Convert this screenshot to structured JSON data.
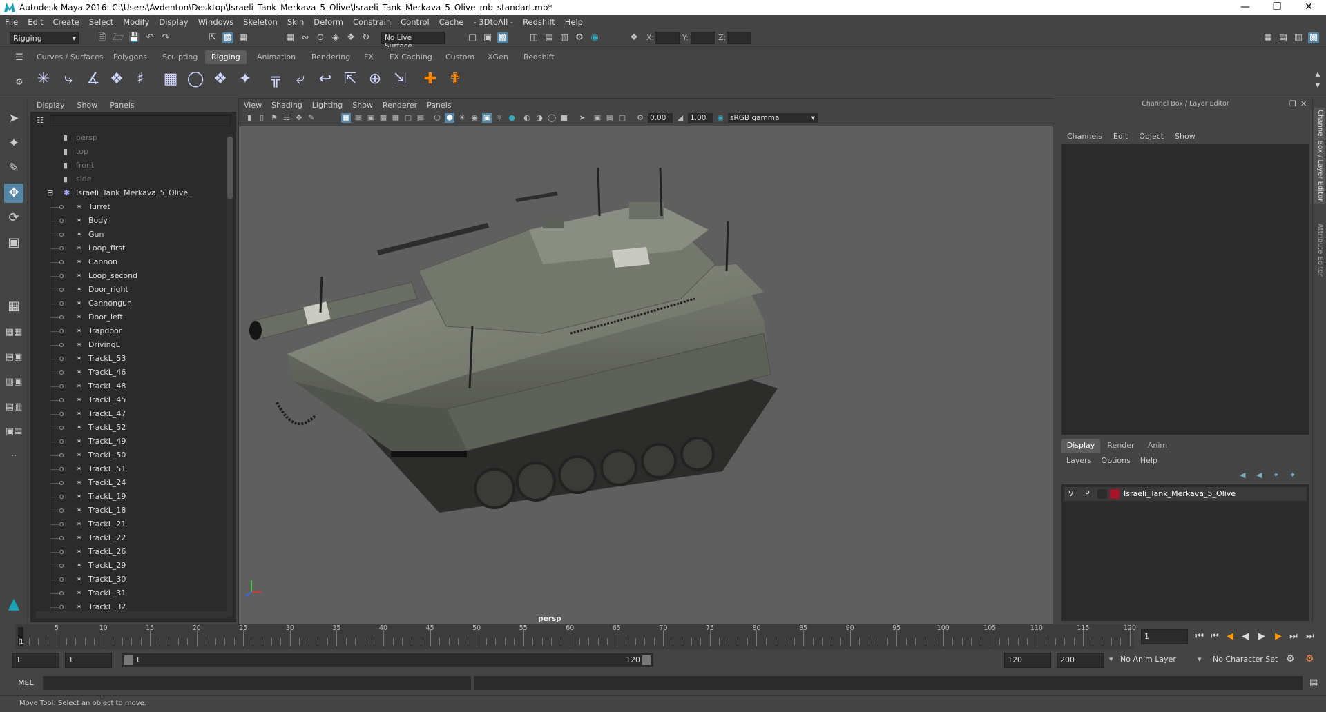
{
  "window": {
    "title": "Autodesk Maya 2016: C:\\Users\\Avdenton\\Desktop\\Israeli_Tank_Merkava_5_Olive\\Israeli_Tank_Merkava_5_Olive_mb_standart.mb*"
  },
  "menubar": [
    "File",
    "Edit",
    "Create",
    "Select",
    "Modify",
    "Display",
    "Windows",
    "Skeleton",
    "Skin",
    "Deform",
    "Constrain",
    "Control",
    "Cache",
    "- 3DtoAll -",
    "Redshift",
    "Help"
  ],
  "statusline": {
    "menuset": "Rigging",
    "live_surface": "No Live Surface",
    "x_label": "X:",
    "y_label": "Y:",
    "z_label": "Z:"
  },
  "shelf_tabs": [
    "Curves / Surfaces",
    "Polygons",
    "Sculpting",
    "Rigging",
    "Animation",
    "Rendering",
    "FX",
    "FX Caching",
    "Custom",
    "XGen",
    "Redshift"
  ],
  "shelf_selected": "Rigging",
  "outliner": {
    "menu": [
      "Display",
      "Show",
      "Panels"
    ],
    "cameras": [
      "persp",
      "top",
      "front",
      "side"
    ],
    "root": "Israeli_Tank_Merkava_5_Olive_",
    "children": [
      "Turret",
      "Body",
      "Gun",
      "Loop_first",
      "Cannon",
      "Loop_second",
      "Door_right",
      "Cannongun",
      "Door_left",
      "Trapdoor",
      "DrivingL",
      "TrackL_53",
      "TrackL_46",
      "TrackL_48",
      "TrackL_45",
      "TrackL_47",
      "TrackL_52",
      "TrackL_49",
      "TrackL_50",
      "TrackL_51",
      "TrackL_24",
      "TrackL_19",
      "TrackL_18",
      "TrackL_21",
      "TrackL_22",
      "TrackL_26",
      "TrackL_29",
      "TrackL_30",
      "TrackL_31",
      "TrackL_32"
    ]
  },
  "viewport": {
    "menu": [
      "View",
      "Shading",
      "Lighting",
      "Show",
      "Renderer",
      "Panels"
    ],
    "exposure": "0.00",
    "gamma": "1.00",
    "color_space": "sRGB gamma",
    "camera_label": "persp"
  },
  "channel_box": {
    "title": "Channel Box / Layer Editor",
    "menu": [
      "Channels",
      "Edit",
      "Object",
      "Show"
    ]
  },
  "layer_editor": {
    "tabs": [
      "Display",
      "Render",
      "Anim"
    ],
    "menu": [
      "Layers",
      "Options",
      "Help"
    ],
    "layer": {
      "v": "V",
      "p": "P",
      "name": "Israeli_Tank_Merkava_5_Olive",
      "color": "#a8152a"
    }
  },
  "side_tabs": [
    "Channel Box / Layer Editor",
    "Attribute Editor"
  ],
  "timeline": {
    "ticks": [
      "5",
      "10",
      "15",
      "20",
      "25",
      "30",
      "35",
      "40",
      "45",
      "50",
      "55",
      "60",
      "65",
      "70",
      "75",
      "80",
      "85",
      "90",
      "95",
      "100",
      "105",
      "110",
      "115",
      "120"
    ],
    "start_marker": "1",
    "current_frame": "1"
  },
  "range": {
    "start": "1",
    "playback_start": "1",
    "slider_start": "1",
    "slider_end": "120",
    "playback_end": "120",
    "end": "200",
    "anim_layer": "No Anim Layer",
    "character_set": "No Character Set"
  },
  "cmdline": {
    "label": "MEL"
  },
  "help_line": "Move Tool: Select an object to move.",
  "accent_color": "#5285a6"
}
